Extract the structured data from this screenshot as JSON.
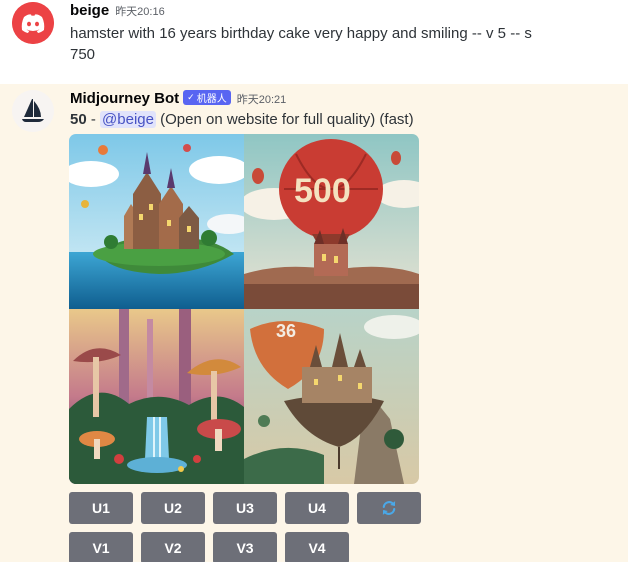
{
  "messages": [
    {
      "username": "beige",
      "timestamp": "昨天20:16",
      "line1": "hamster with 16 years birthday cake very happy and smiling -- v 5 -- s",
      "line2": "750",
      "avatar": "discord-logo-icon",
      "avatar_color": "#ec4245"
    },
    {
      "username": "Midjourney Bot",
      "bot_tag": "机器人",
      "tag_check": "✓",
      "timestamp": "昨天20:21",
      "number": "50",
      "separator": " - ",
      "mention": "@beige",
      "text": " (Open on website for full quality) (fast)",
      "avatar": "midjourney-boat-logo",
      "tag_color": "#5865f2",
      "background": "#fdf6e8"
    }
  ],
  "image_grid": {
    "images": [
      {
        "alt": "floating island with castle and balloons"
      },
      {
        "alt": "red hot air balloon with 500"
      },
      {
        "alt": "fantasy mushroom forest with waterfall"
      },
      {
        "alt": "floating castle with 36"
      }
    ],
    "tile_text": {
      "balloon": "500",
      "castle": "36"
    }
  },
  "buttons": {
    "upscale": [
      "U1",
      "U2",
      "U3",
      "U4"
    ],
    "variation": [
      "V1",
      "V2",
      "V3",
      "V4"
    ],
    "reroll_icon": "refresh-icon",
    "button_color": "#6d6f78"
  }
}
